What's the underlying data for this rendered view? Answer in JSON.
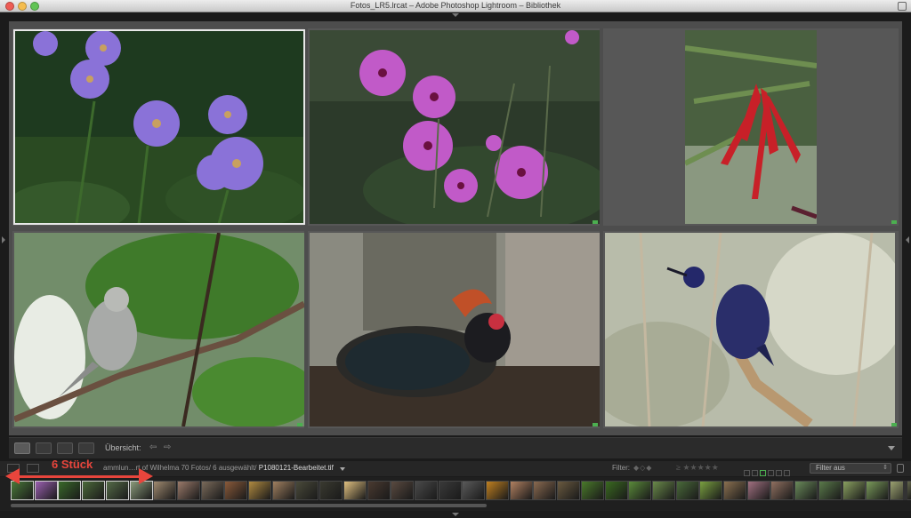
{
  "window": {
    "title": "Fotos_LR5.lrcat – Adobe Photoshop Lightroom – Bibliothek"
  },
  "grid": {
    "photos": [
      {
        "name": "purple-aster-flowers",
        "selected": true
      },
      {
        "name": "pink-geranium-flowers",
        "selected": false
      },
      {
        "name": "red-kakabeak-flower",
        "selected": false
      },
      {
        "name": "gray-bird-on-branch",
        "selected": false
      },
      {
        "name": "crested-wood-partridge",
        "selected": false
      },
      {
        "name": "blue-sunbird-on-branch",
        "selected": false
      }
    ]
  },
  "toolbar": {
    "sort_label": "Übersicht:",
    "prev_label": "⇦",
    "next_label": "⇨"
  },
  "filmbar": {
    "path_prefix": "ammlun",
    "path_text": "…rt of Wilhelma   70 Fotos/ 6 ausgewählt/",
    "filename": "P1080121-Bearbeitet.tif",
    "filter_label": "Filter:",
    "filter_value": "Filter aus",
    "stars_op": "≥",
    "stars": "★★★★★"
  },
  "annotation": {
    "text": "6 Stück"
  },
  "colors": {
    "accent_annotation": "#e8453c",
    "flag_green": "#4caf50",
    "selection_border": "#e8e8e8"
  }
}
